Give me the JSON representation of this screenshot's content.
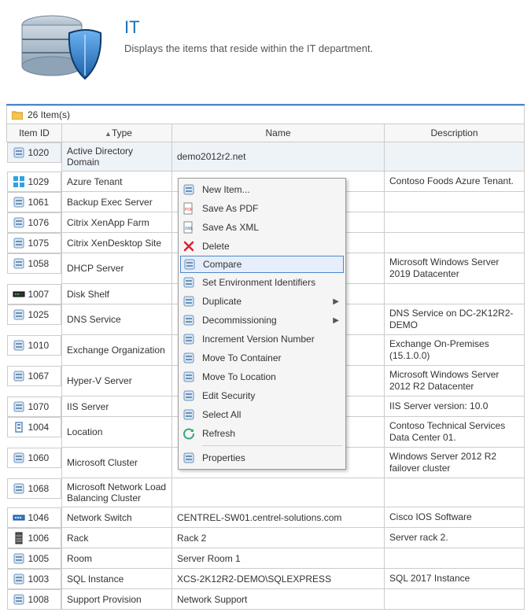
{
  "header": {
    "title": "IT",
    "subtitle": "Displays the items that reside within the IT department."
  },
  "count_bar": {
    "text": "26 Item(s)"
  },
  "columns": {
    "id": "Item ID",
    "type": "Type",
    "name": "Name",
    "description": "Description"
  },
  "rows": [
    {
      "id": "1020",
      "type": "Active Directory Domain",
      "name": "demo2012r2.net",
      "description": ""
    },
    {
      "id": "1029",
      "type": "Azure Tenant",
      "name": "",
      "description": "Contoso Foods Azure Tenant."
    },
    {
      "id": "1061",
      "type": "Backup Exec Server",
      "name": "",
      "description": ""
    },
    {
      "id": "1076",
      "type": "Citrix XenApp Farm",
      "name": "",
      "description": ""
    },
    {
      "id": "1075",
      "type": "Citrix XenDesktop Site",
      "name": "",
      "description": ""
    },
    {
      "id": "1058",
      "type": "DHCP Server",
      "name": "",
      "description": "Microsoft Windows Server 2019 Datacenter"
    },
    {
      "id": "1007",
      "type": "Disk Shelf",
      "name": "",
      "description": ""
    },
    {
      "id": "1025",
      "type": "DNS Service",
      "name": "",
      "description": "DNS Service on DC-2K12R2-DEMO"
    },
    {
      "id": "1010",
      "type": "Exchange Organization",
      "name": "",
      "description": "Exchange On-Premises (15.1.0.0)"
    },
    {
      "id": "1067",
      "type": "Hyper-V Server",
      "name": "",
      "description": "Microsoft Windows Server 2012 R2 Datacenter"
    },
    {
      "id": "1070",
      "type": "IIS Server",
      "name": "",
      "description": "IIS Server version: 10.0"
    },
    {
      "id": "1004",
      "type": "Location",
      "name": "",
      "description": "Contoso Technical Services Data Center 01."
    },
    {
      "id": "1060",
      "type": "Microsoft Cluster",
      "name": "",
      "description": "Windows Server 2012 R2 failover cluster"
    },
    {
      "id": "1068",
      "type": "Microsoft Network Load Balancing Cluster",
      "name": "",
      "description": ""
    },
    {
      "id": "1046",
      "type": "Network Switch",
      "name": "CENTREL-SW01.centrel-solutions.com",
      "description": "Cisco IOS Software"
    },
    {
      "id": "1006",
      "type": "Rack",
      "name": "Rack 2",
      "description": "Server rack 2."
    },
    {
      "id": "1005",
      "type": "Room",
      "name": "Server Room 1",
      "description": ""
    },
    {
      "id": "1003",
      "type": "SQL Instance",
      "name": "XCS-2K12R2-DEMO\\SQLEXPRESS",
      "description": "SQL 2017 Instance"
    },
    {
      "id": "1008",
      "type": "Support Provision",
      "name": "Network Support",
      "description": ""
    }
  ],
  "row_icons": {
    "1020": "ad-domain-icon",
    "1029": "azure-icon",
    "1061": "backup-icon",
    "1076": "citrix-icon",
    "1075": "citrix-icon",
    "1058": "dhcp-icon",
    "1007": "disk-shelf-icon",
    "1025": "dns-icon",
    "1010": "exchange-icon",
    "1067": "hyperv-icon",
    "1070": "iis-icon",
    "1004": "location-icon",
    "1060": "cluster-icon",
    "1068": "nlb-icon",
    "1046": "switch-icon",
    "1006": "rack-icon",
    "1005": "room-icon",
    "1003": "sql-icon",
    "1008": "support-icon"
  },
  "context_menu": {
    "items": [
      {
        "label": "New Item...",
        "icon": "new-item-icon"
      },
      {
        "label": "Save As PDF",
        "icon": "pdf-icon"
      },
      {
        "label": "Save As XML",
        "icon": "xml-icon"
      },
      {
        "label": "Delete",
        "icon": "delete-icon"
      },
      {
        "label": "Compare",
        "icon": "compare-icon",
        "highlighted": true
      },
      {
        "label": "Set Environment Identifiers",
        "icon": "env-id-icon"
      },
      {
        "label": "Duplicate",
        "icon": "duplicate-icon",
        "submenu": true
      },
      {
        "label": "Decommissioning",
        "icon": "decommission-icon",
        "submenu": true
      },
      {
        "label": "Increment Version Number",
        "icon": "increment-icon"
      },
      {
        "label": "Move To Container",
        "icon": "move-container-icon"
      },
      {
        "label": "Move To Location",
        "icon": "move-location-icon"
      },
      {
        "label": "Edit Security",
        "icon": "security-icon"
      },
      {
        "label": "Select All",
        "icon": "select-all-icon"
      },
      {
        "label": "Refresh",
        "icon": "refresh-icon"
      },
      {
        "sep": true
      },
      {
        "label": "Properties",
        "icon": "properties-icon"
      }
    ]
  }
}
